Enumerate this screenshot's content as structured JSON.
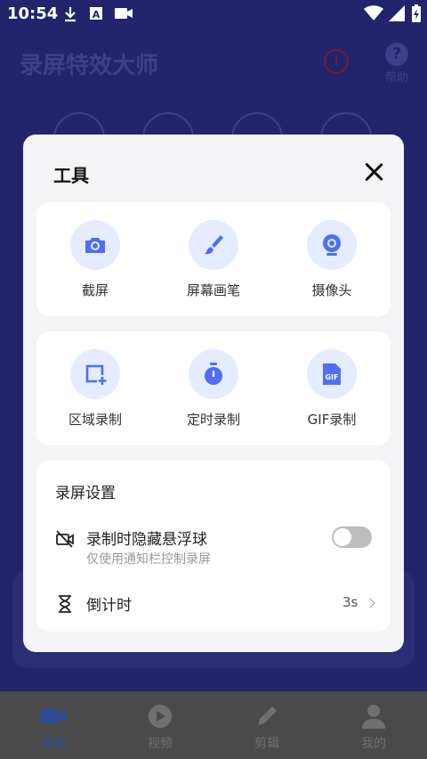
{
  "status_bar": {
    "time": "10:54"
  },
  "app": {
    "title": "录屏特效大师",
    "help_label": "帮助"
  },
  "bottom_nav": [
    {
      "label": "录制",
      "icon": "video-camera-icon",
      "active": true
    },
    {
      "label": "视频",
      "icon": "play-icon",
      "active": false
    },
    {
      "label": "剪辑",
      "icon": "pencil-icon",
      "active": false
    },
    {
      "label": "我的",
      "icon": "person-icon",
      "active": false
    }
  ],
  "dialog": {
    "title": "工具",
    "tools_row1": [
      {
        "label": "截屏",
        "icon": "camera-icon"
      },
      {
        "label": "屏幕画笔",
        "icon": "brush-icon"
      },
      {
        "label": "摄像头",
        "icon": "webcam-icon"
      }
    ],
    "tools_row2": [
      {
        "label": "区域录制",
        "icon": "region-add-icon"
      },
      {
        "label": "定时录制",
        "icon": "timer-icon"
      },
      {
        "label": "GIF录制",
        "icon": "gif-file-icon"
      }
    ],
    "settings": {
      "title": "录屏设置",
      "hide_float": {
        "label": "录制时隐藏悬浮球",
        "sublabel": "仅使用通知栏控制录屏",
        "enabled": false
      },
      "countdown": {
        "label": "倒计时",
        "value": "3s"
      }
    }
  },
  "colors": {
    "accent": "#4f6ef7",
    "icon_bg": "#e6ecff",
    "overlay_bg": "#23246b"
  }
}
